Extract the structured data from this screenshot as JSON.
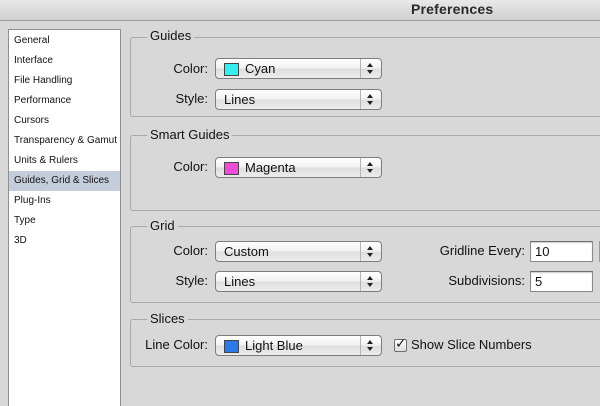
{
  "window": {
    "title": "Preferences"
  },
  "sidebar": {
    "items": [
      {
        "label": "General"
      },
      {
        "label": "Interface"
      },
      {
        "label": "File Handling"
      },
      {
        "label": "Performance"
      },
      {
        "label": "Cursors"
      },
      {
        "label": "Transparency & Gamut"
      },
      {
        "label": "Units & Rulers"
      },
      {
        "label": "Guides, Grid & Slices",
        "selected": true
      },
      {
        "label": "Plug-Ins"
      },
      {
        "label": "Type"
      },
      {
        "label": "3D"
      }
    ]
  },
  "guides": {
    "title": "Guides",
    "color_label": "Color:",
    "color_value": "Cyan",
    "color_swatch": "#33f0f0",
    "style_label": "Style:",
    "style_value": "Lines"
  },
  "smart_guides": {
    "title": "Smart Guides",
    "color_label": "Color:",
    "color_value": "Magenta",
    "color_swatch": "#f04cd8"
  },
  "grid": {
    "title": "Grid",
    "color_label": "Color:",
    "color_value": "Custom",
    "style_label": "Style:",
    "style_value": "Lines",
    "gridline_label": "Gridline Every:",
    "gridline_value": "10",
    "subdivisions_label": "Subdivisions:",
    "subdivisions_value": "5"
  },
  "slices": {
    "title": "Slices",
    "line_color_label": "Line Color:",
    "line_color_value": "Light Blue",
    "line_color_swatch": "#2a7bea",
    "show_numbers_label": "Show Slice Numbers",
    "show_numbers_checked": true
  }
}
